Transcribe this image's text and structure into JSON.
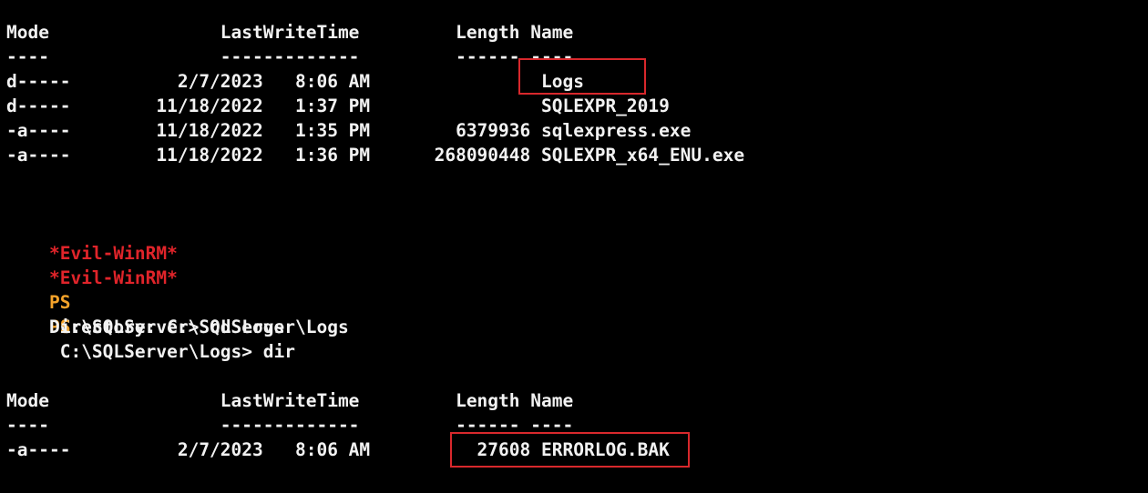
{
  "listing1": {
    "header": "Mode                LastWriteTime         Length Name",
    "separator": "----                -------------         ------ ----",
    "rows": [
      "d-----          2/7/2023   8:06 AM                Logs",
      "d-----        11/18/2022   1:37 PM                SQLEXPR_2019",
      "-a----        11/18/2022   1:35 PM        6379936 sqlexpress.exe",
      "-a----        11/18/2022   1:36 PM      268090448 SQLEXPR_x64_ENU.exe"
    ]
  },
  "commands": [
    {
      "label": "*Evil-WinRM*",
      "ps": "PS",
      "text": " C:\\SQLServer> cd Logs"
    },
    {
      "label": "*Evil-WinRM*",
      "ps": "PS",
      "text": " C:\\SQLServer\\Logs> dir"
    }
  ],
  "directory_line": "    Directory: C:\\SQLServer\\Logs",
  "listing2": {
    "header": "Mode                LastWriteTime         Length Name",
    "separator": "----                -------------         ------ ----",
    "rows": [
      "-a----          2/7/2023   8:06 AM          27608 ERRORLOG.BAK"
    ]
  },
  "colors": {
    "background": "#000000",
    "text": "#f2f2f2",
    "prompt_label": "#e0242a",
    "prompt_ps": "#f5a32a",
    "highlight_border": "#d8282c"
  }
}
